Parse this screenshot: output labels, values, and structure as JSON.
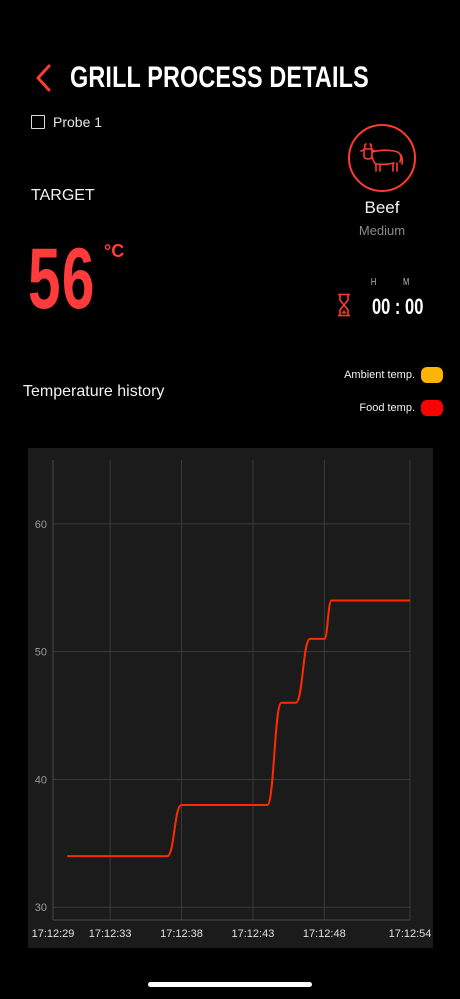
{
  "header": {
    "title": "GRILL PROCESS DETAILS"
  },
  "probe": {
    "label": "Probe 1",
    "checked": false
  },
  "target": {
    "label": "TARGET",
    "value": "56",
    "unit": "°C"
  },
  "meat": {
    "icon": "cow-icon",
    "name": "Beef",
    "doneness": "Medium"
  },
  "timer": {
    "h_label": "H",
    "m_label": "M",
    "value": "00 : 00",
    "icon": "hourglass-icon"
  },
  "history": {
    "title": "Temperature history",
    "legend": {
      "ambient_label": "Ambient temp.",
      "food_label": "Food temp."
    }
  },
  "colors": {
    "accent": "#ff3b30",
    "ambient": "#ffb400",
    "food": "#ff0000",
    "background": "#000000",
    "chart_background": "#1b1b1b"
  },
  "chart_data": {
    "type": "line",
    "title": "",
    "xlabel": "",
    "ylabel": "",
    "x_ticks": [
      "17:12:29",
      "17:12:33",
      "17:12:38",
      "17:12:43",
      "17:12:48",
      "17:12:54"
    ],
    "y_ticks": [
      30,
      40,
      50,
      60
    ],
    "ylim": [
      29,
      65
    ],
    "grid": true,
    "series": [
      {
        "name": "Food temp.",
        "color": "#ff2a00",
        "points": [
          [
            "17:12:30",
            34
          ],
          [
            "17:12:37",
            34
          ],
          [
            "17:12:38",
            38
          ],
          [
            "17:12:44",
            38
          ],
          [
            "17:12:45",
            46
          ],
          [
            "17:12:46",
            46
          ],
          [
            "17:12:47",
            51
          ],
          [
            "17:12:48",
            51
          ],
          [
            "17:12:48.5",
            54
          ],
          [
            "17:12:54",
            54
          ]
        ]
      }
    ]
  }
}
